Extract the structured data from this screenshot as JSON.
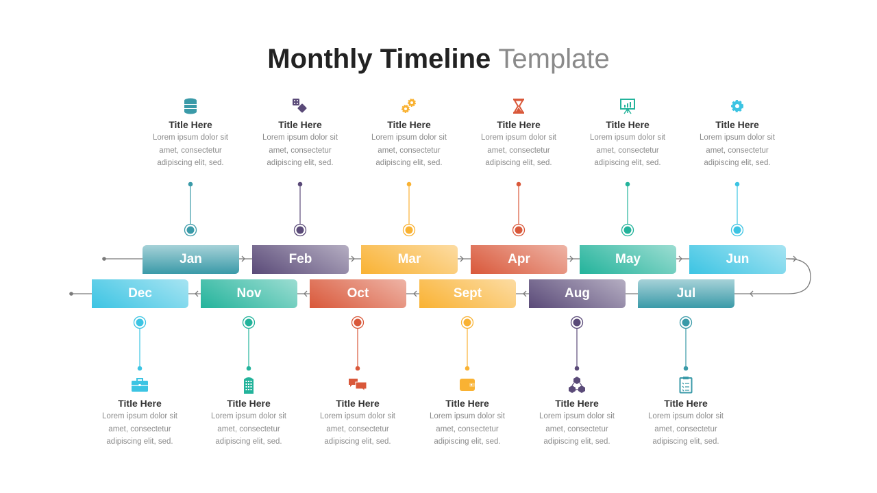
{
  "header": {
    "title_bold": "Monthly Timeline",
    "title_light": "Template"
  },
  "colors": {
    "teal": "#3a9aa8",
    "purple": "#5a4a78",
    "yellow": "#f9b233",
    "red": "#d9583a",
    "green": "#23b39b",
    "cyan": "#3cc4e3"
  },
  "months": [
    {
      "label": "Jan",
      "title": "Title Here",
      "desc": [
        "Lorem ipsum dolor sit",
        "amet, consectetur",
        "adipiscing elit, sed."
      ],
      "icon": "database-icon",
      "color": "teal"
    },
    {
      "label": "Feb",
      "title": "Title Here",
      "desc": [
        "Lorem ipsum dolor sit",
        "amet, consectetur",
        "adipiscing elit, sed."
      ],
      "icon": "dice-icon",
      "color": "purple"
    },
    {
      "label": "Mar",
      "title": "Title Here",
      "desc": [
        "Lorem ipsum dolor sit",
        "amet, consectetur",
        "adipiscing elit, sed."
      ],
      "icon": "gears-icon",
      "color": "yellow"
    },
    {
      "label": "Apr",
      "title": "Title Here",
      "desc": [
        "Lorem ipsum dolor sit",
        "amet, consectetur",
        "adipiscing elit, sed."
      ],
      "icon": "hourglass-icon",
      "color": "red"
    },
    {
      "label": "May",
      "title": "Title Here",
      "desc": [
        "Lorem ipsum dolor sit",
        "amet, consectetur",
        "adipiscing elit, sed."
      ],
      "icon": "presentation-icon",
      "color": "green"
    },
    {
      "label": "Jun",
      "title": "Title Here",
      "desc": [
        "Lorem ipsum dolor sit",
        "amet, consectetur",
        "adipiscing elit, sed."
      ],
      "icon": "gear-icon",
      "color": "cyan"
    },
    {
      "label": "Jul",
      "title": "Title Here",
      "desc": [
        "Lorem ipsum dolor sit",
        "amet, consectetur",
        "adipiscing elit, sed."
      ],
      "icon": "clipboard-icon",
      "color": "teal"
    },
    {
      "label": "Aug",
      "title": "Title Here",
      "desc": [
        "Lorem ipsum dolor sit",
        "amet, consectetur",
        "adipiscing elit, sed."
      ],
      "icon": "cubes-network-icon",
      "color": "purple"
    },
    {
      "label": "Sept",
      "title": "Title Here",
      "desc": [
        "Lorem ipsum dolor sit",
        "amet, consectetur",
        "adipiscing elit, sed."
      ],
      "icon": "wallet-icon",
      "color": "yellow"
    },
    {
      "label": "Oct",
      "title": "Title Here",
      "desc": [
        "Lorem ipsum dolor sit",
        "amet, consectetur",
        "adipiscing elit, sed."
      ],
      "icon": "chat-bubbles-icon",
      "color": "red"
    },
    {
      "label": "Nov",
      "title": "Title Here",
      "desc": [
        "Lorem ipsum dolor sit",
        "amet, consectetur",
        "adipiscing elit, sed."
      ],
      "icon": "building-icon",
      "color": "green"
    },
    {
      "label": "Dec",
      "title": "Title Here",
      "desc": [
        "Lorem ipsum dolor sit",
        "amet, consectetur",
        "adipiscing elit, sed."
      ],
      "icon": "briefcase-icon",
      "color": "cyan"
    }
  ]
}
